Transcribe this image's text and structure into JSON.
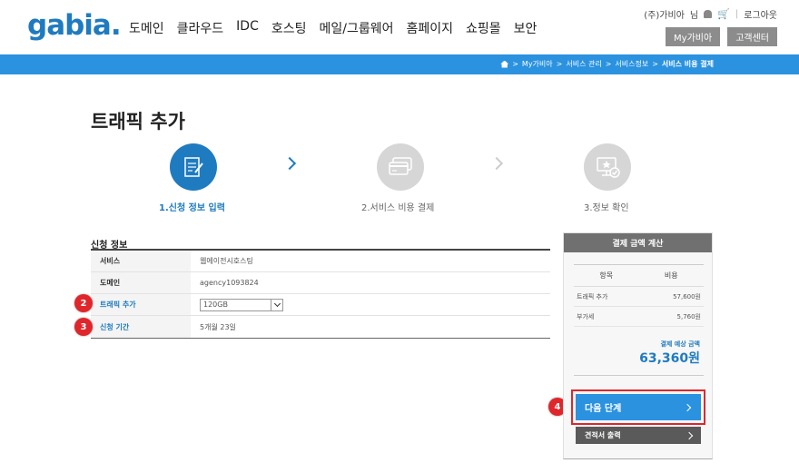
{
  "header": {
    "logo": "gabia.",
    "nav": [
      "도메인",
      "클라우드",
      "IDC",
      "호스팅",
      "메일/그룹웨어",
      "홈페이지",
      "쇼핑몰",
      "보안"
    ],
    "user_name": "(주)가비아",
    "user_suffix": "님",
    "logout": "로그아웃",
    "buttons": [
      "My가비아",
      "고객센터"
    ]
  },
  "breadcrumb": {
    "items": [
      "My가비아",
      "서비스 관리",
      "서비스정보"
    ],
    "current": "서비스 비용 결제"
  },
  "page_title": "트래픽 추가",
  "steps": [
    {
      "label": "1.신청 정보 입력",
      "state": "active"
    },
    {
      "label": "2.서비스 비용 결제",
      "state": "inactive"
    },
    {
      "label": "3.정보 확인",
      "state": "inactive"
    }
  ],
  "info": {
    "section_title": "신청 정보",
    "rows": [
      {
        "label": "서비스",
        "value": "웹에이전시호스팅"
      },
      {
        "label": "도메인",
        "value": "agency1093824"
      },
      {
        "label": "트래픽 추가",
        "value": "120GB"
      },
      {
        "label": "신청 기간",
        "value": "5개월 23일"
      }
    ]
  },
  "markers": [
    "2",
    "3",
    "4"
  ],
  "payment": {
    "title": "결제 금액 계산",
    "col_item": "항목",
    "col_cost": "비용",
    "rows": [
      {
        "item": "트래픽 추가",
        "cost": "57,600원"
      },
      {
        "item": "부가세",
        "cost": "5,760원"
      }
    ],
    "total_label": "결제 예상 금액",
    "total_value": "63,360원",
    "next_label": "다음 단계",
    "print_label": "견적서 출력"
  },
  "colors": {
    "brand_blue": "#2b92e0",
    "marker_red": "#e0262b"
  }
}
